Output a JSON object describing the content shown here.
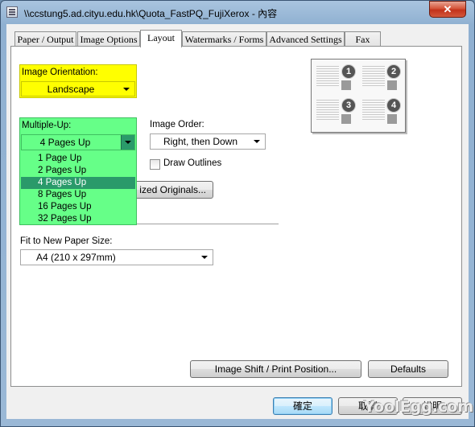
{
  "window": {
    "title": "\\\\ccstung5.ad.cityu.edu.hk\\Quota_FastPQ_FujiXerox - 內容",
    "close_label": "✕"
  },
  "tabs": [
    {
      "label": "Paper / Output",
      "active": false
    },
    {
      "label": "Image Options",
      "active": false
    },
    {
      "label": "Layout",
      "active": true
    },
    {
      "label": "Watermarks / Forms",
      "active": false
    },
    {
      "label": "Advanced Settings",
      "active": false
    },
    {
      "label": "Fax",
      "active": false
    }
  ],
  "layout": {
    "orientation": {
      "label": "Image Orientation:",
      "value": "Landscape"
    },
    "multiple_up": {
      "label": "Multiple-Up:",
      "value": "4 Pages Up",
      "options": [
        "1 Page Up",
        "2 Pages Up",
        "4 Pages Up",
        "8 Pages Up",
        "16 Pages Up",
        "32 Pages Up"
      ],
      "selected_option": "4 Pages Up"
    },
    "image_order": {
      "label": "Image Order:",
      "value": "Right, then Down"
    },
    "draw_outlines": {
      "label": "Draw Outlines",
      "checked": false
    },
    "originals_button_label": "ized Originals...",
    "fit_paper": {
      "label": "Fit to New Paper Size:",
      "value": "A4 (210 x 297mm)"
    },
    "preview_numbers": [
      "1",
      "2",
      "3",
      "4"
    ],
    "image_shift_button_label": "Image Shift / Print Position...",
    "defaults_button_label": "Defaults"
  },
  "footer": {
    "ok_label": "確定",
    "cancel_label": "取消",
    "help_label": "說明"
  },
  "watermark": {
    "text": "YoolEgg.com"
  },
  "colors": {
    "highlight_yellow": "#ffff00",
    "highlight_green": "#66ff88",
    "selected_item": "#2a9a6a"
  }
}
